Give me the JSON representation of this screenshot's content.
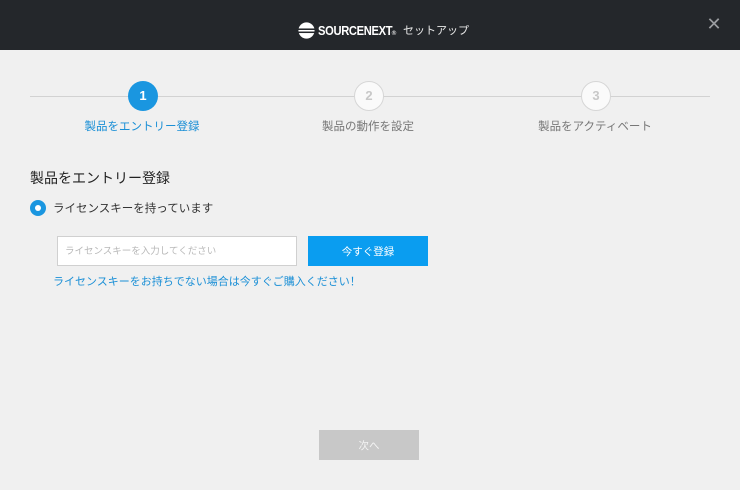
{
  "window": {
    "brand": "SOURCENEXT",
    "brand_mark": "®",
    "title": "セットアップ",
    "close_glyph": "✕"
  },
  "steps": [
    {
      "number": "1",
      "label": "製品をエントリー登録",
      "state": "active"
    },
    {
      "number": "2",
      "label": "製品の動作を設定",
      "state": "inactive"
    },
    {
      "number": "3",
      "label": "製品をアクティベート",
      "state": "inactive"
    }
  ],
  "section": {
    "title": "製品をエントリー登録",
    "option_label": "ライセンスキーを持っています",
    "option_selected": true
  },
  "license": {
    "placeholder": "ライセンスキーを入力してください",
    "value": "",
    "register_label": "今すぐ登録",
    "buy_link": "ライセンスキーをお持ちでない場合は今すぐご購入ください！"
  },
  "footer": {
    "next_label": "次へ",
    "next_enabled": false
  },
  "colors": {
    "titlebar": "#24272b",
    "accent": "#1a96e0",
    "link": "#1a8fd6",
    "disabled": "#c8c8c8"
  },
  "icons": {
    "brand_logo": "sourcenext-logo-icon",
    "close": "close-icon"
  }
}
